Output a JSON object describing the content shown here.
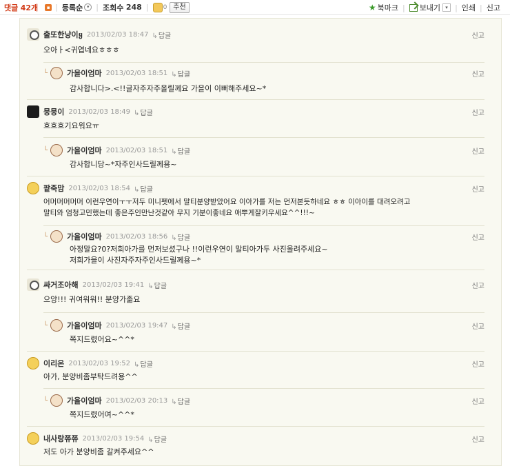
{
  "toolbar": {
    "comments_label": "댓글",
    "comments_count": "42개",
    "sort_label": "등록순",
    "views_label": "조회수",
    "views_value": "248",
    "like_count": "0",
    "recommend_label": "추천",
    "bookmark_label": "북마크",
    "send_label": "보내기",
    "print_label": "인쇄",
    "report_label": "신고"
  },
  "comments": [
    {
      "nick": "출또한냥이ყ",
      "date": "2013/02/03 18:47",
      "reply": "답글",
      "report": "신고",
      "text": "오아ㅏ<귀엽네요ㅎㅎㅎ",
      "reply_comment": false,
      "avatar": "panda"
    },
    {
      "nick": "가을이엄마",
      "date": "2013/02/03 18:51",
      "reply": "답글",
      "report": "신고",
      "text": "감사합니다>.<!!글자주자주올릴께요 가을이 이뻐해주세요~*",
      "reply_comment": true,
      "avatar": "mom"
    },
    {
      "nick": "뭉뭉이",
      "date": "2013/02/03 18:49",
      "reply": "답글",
      "report": "신고",
      "text": "흐흐흐기요워요ㅠ",
      "reply_comment": false,
      "avatar": "dark"
    },
    {
      "nick": "가을이엄마",
      "date": "2013/02/03 18:51",
      "reply": "답글",
      "report": "신고",
      "text": "감사합니당~*자주인사드릴께용~",
      "reply_comment": true,
      "avatar": "mom"
    },
    {
      "nick": "팥죽맘",
      "date": "2013/02/03 18:54",
      "reply": "답글",
      "report": "신고",
      "text": "어머머머머머 이런우연이ㅜㅜ저두 미니펫에서 말티분양받았어요 이아가를 저는 먼저본듯하네요 ㅎㅎ 이아이를 대려오려고\n말티와 엄청고민했는데 좋은주인만난것같아 무지 기분이좋네요 애뿌게잘키우세요^^!!!~",
      "reply_comment": false,
      "avatar": "face"
    },
    {
      "nick": "가을이엄마",
      "date": "2013/02/03 18:56",
      "reply": "답글",
      "report": "신고",
      "text": "아정말요?0?저희아가를 먼저보셨구나 !!이런우연이 말티아가두 사진올려주세요~\n저희가을이 사진자주자주인사드릴께용~*",
      "reply_comment": true,
      "avatar": "mom"
    },
    {
      "nick": "싸거조아해",
      "date": "2013/02/03 19:41",
      "reply": "답글",
      "report": "신고",
      "text": "으앙!!! 귀여워워!! 분양가졺요",
      "reply_comment": false,
      "avatar": "panda"
    },
    {
      "nick": "가을이엄마",
      "date": "2013/02/03 19:47",
      "reply": "답글",
      "report": "신고",
      "text": "쪽지드렸어요~^^*",
      "reply_comment": true,
      "avatar": "mom"
    },
    {
      "nick": "이리온",
      "date": "2013/02/03 19:52",
      "reply": "답글",
      "report": "신고",
      "text": "아가, 분양비좀부탁드려용^^",
      "reply_comment": false,
      "avatar": "face"
    },
    {
      "nick": "가을이엄마",
      "date": "2013/02/03 20:13",
      "reply": "답글",
      "report": "신고",
      "text": "쪽지드렸어여~^^*",
      "reply_comment": true,
      "avatar": "mom"
    },
    {
      "nick": "내사랑쮸쮸",
      "date": "2013/02/03 19:54",
      "reply": "답글",
      "report": "신고",
      "text": "저도 아가 분양비좀 갈켜주세요^^",
      "reply_comment": false,
      "avatar": "face"
    }
  ]
}
